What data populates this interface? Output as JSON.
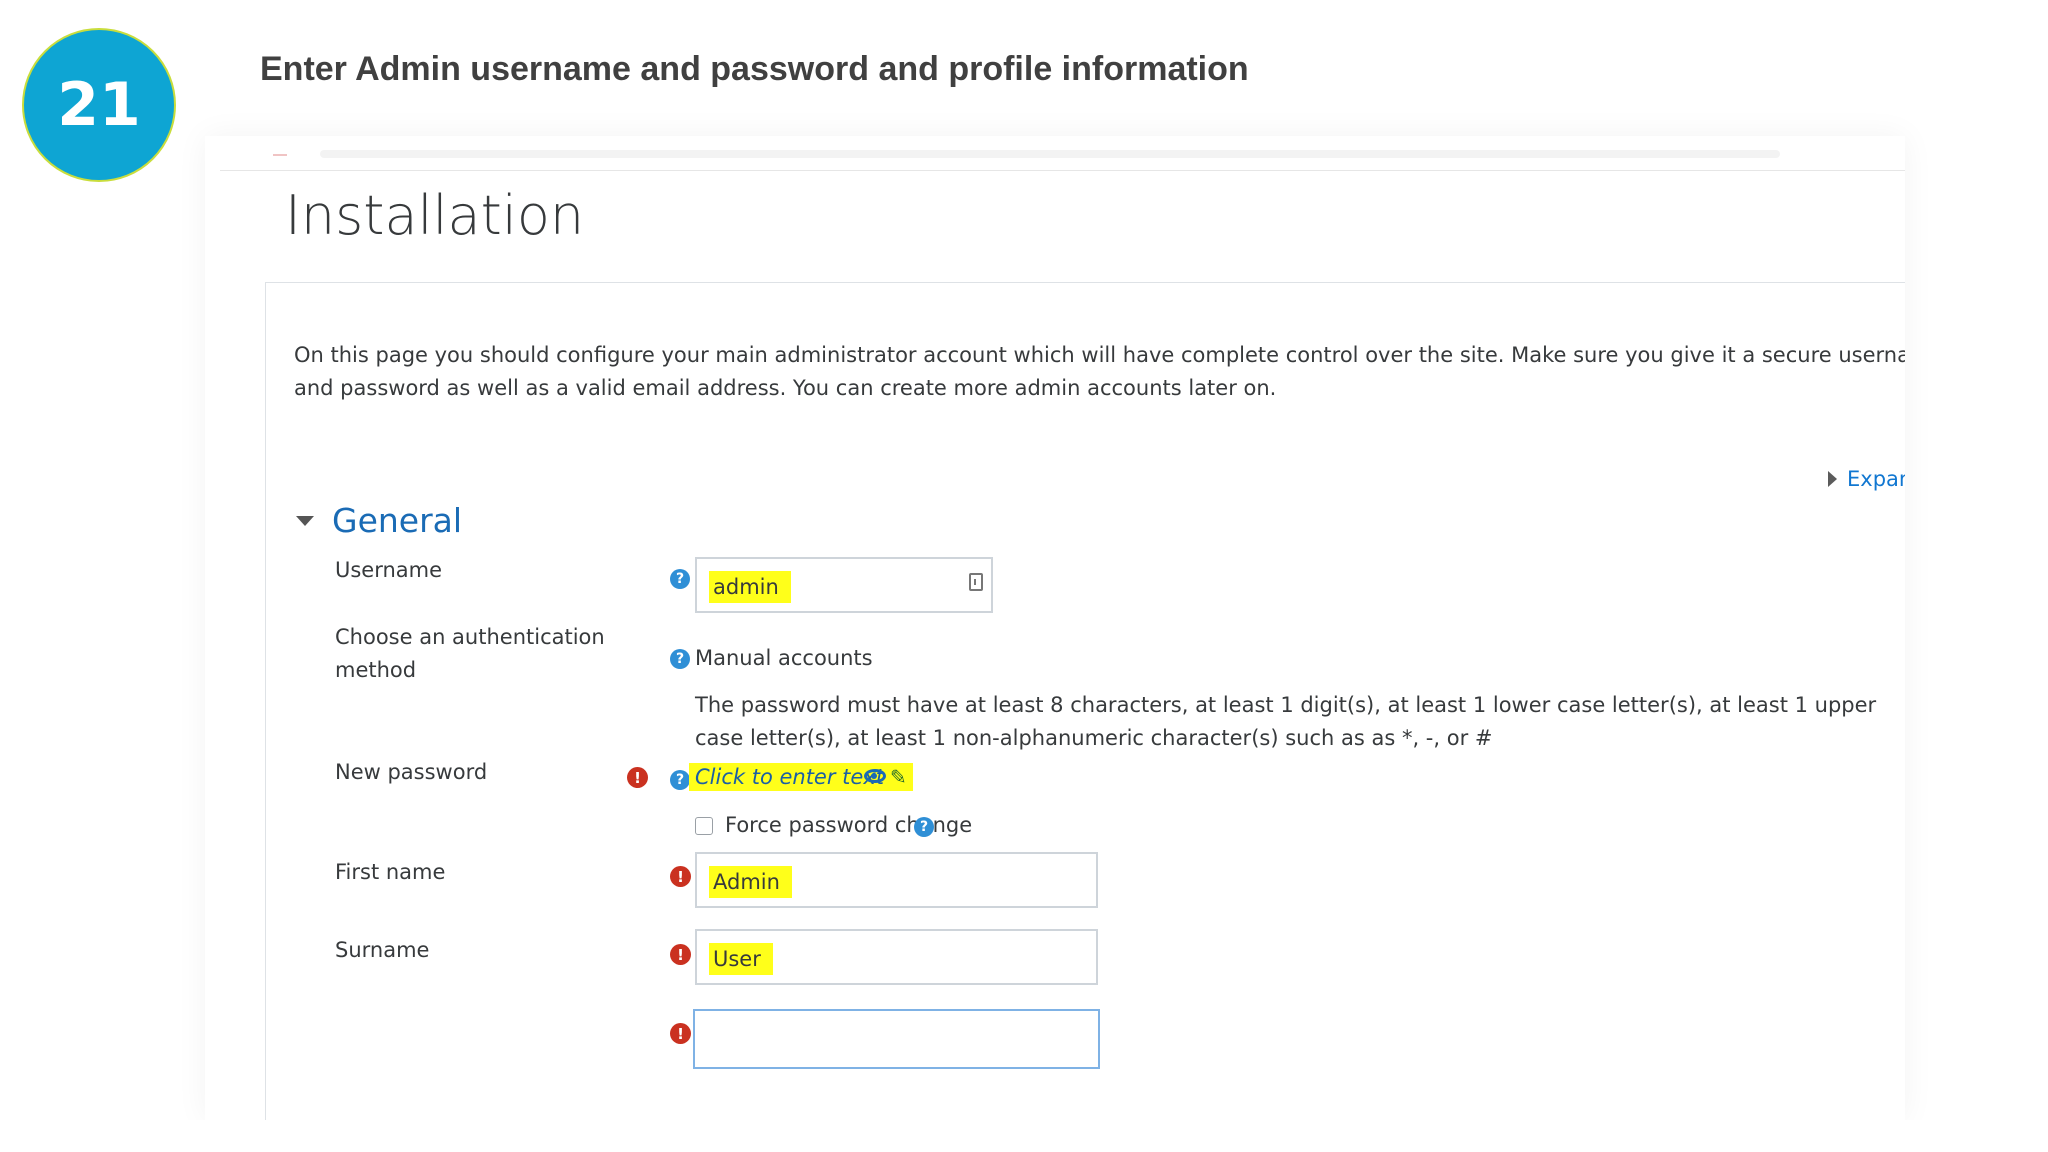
{
  "slide": {
    "step_number": "21",
    "title": "Enter Admin username and password and profile information"
  },
  "page": {
    "title": "Installation",
    "intro": "On this page you should configure your main administrator account which will have complete control over the site. Make sure you give it a secure username and password as well as a valid email address. You can create more admin accounts later on.",
    "expand_label": "Expan",
    "section_label": "General"
  },
  "form": {
    "username_label": "Username",
    "username_value": "admin",
    "auth_label": "Choose an authentication method",
    "auth_value": "Manual accounts",
    "password_rule": "The password must have at least 8 characters, at least 1 digit(s), at least 1 lower case letter(s), at least 1 upper case letter(s), at least 1 non-alphanumeric character(s) such as as *, -, or #",
    "new_password_label": "New password",
    "new_password_placeholder": "Click to enter text",
    "force_change_label": "Force password change",
    "force_change_checked": false,
    "firstname_label": "First name",
    "firstname_value": "Admin",
    "surname_label": "Surname",
    "surname_value": "User"
  },
  "colors": {
    "step_circle": "#0ea5d3",
    "highlight": "#ffff1a",
    "link_blue": "#1a6bb5",
    "required_red": "#ca3120",
    "help_blue": "#2f8fd6"
  }
}
